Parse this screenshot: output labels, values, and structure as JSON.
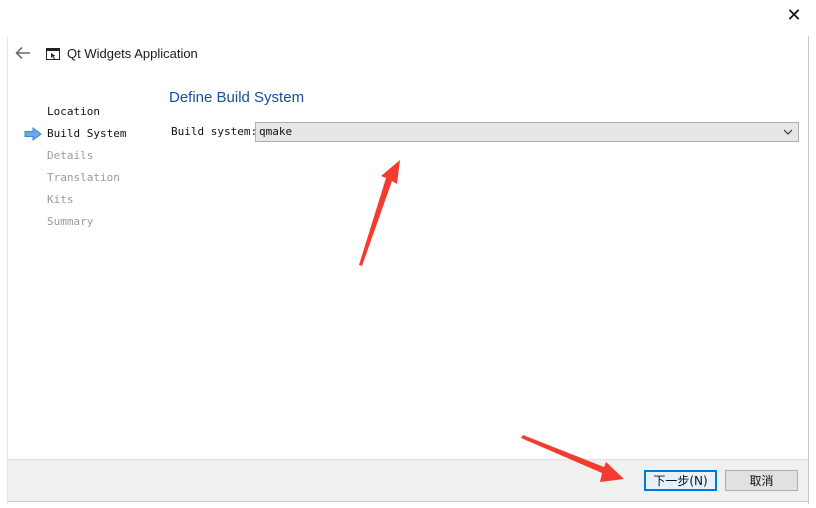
{
  "window": {
    "title": "Qt Widgets Application",
    "close_icon": "close-icon",
    "back_icon": "back-arrow-icon"
  },
  "steps": [
    {
      "label": "Location",
      "state": "done"
    },
    {
      "label": "Build System",
      "state": "current"
    },
    {
      "label": "Details",
      "state": "pending"
    },
    {
      "label": "Translation",
      "state": "pending"
    },
    {
      "label": "Kits",
      "state": "pending"
    },
    {
      "label": "Summary",
      "state": "pending"
    }
  ],
  "page": {
    "title": "Define Build System",
    "build_system_label": "Build system:",
    "build_system_value": "qmake"
  },
  "footer": {
    "next_label": "下一步(N)",
    "cancel_label": "取消"
  },
  "colors": {
    "title_blue": "#1b4d9a",
    "arrow_blue": "#3b86d8",
    "annotation_red": "#f43b2f",
    "focus_blue": "#0078d7"
  }
}
